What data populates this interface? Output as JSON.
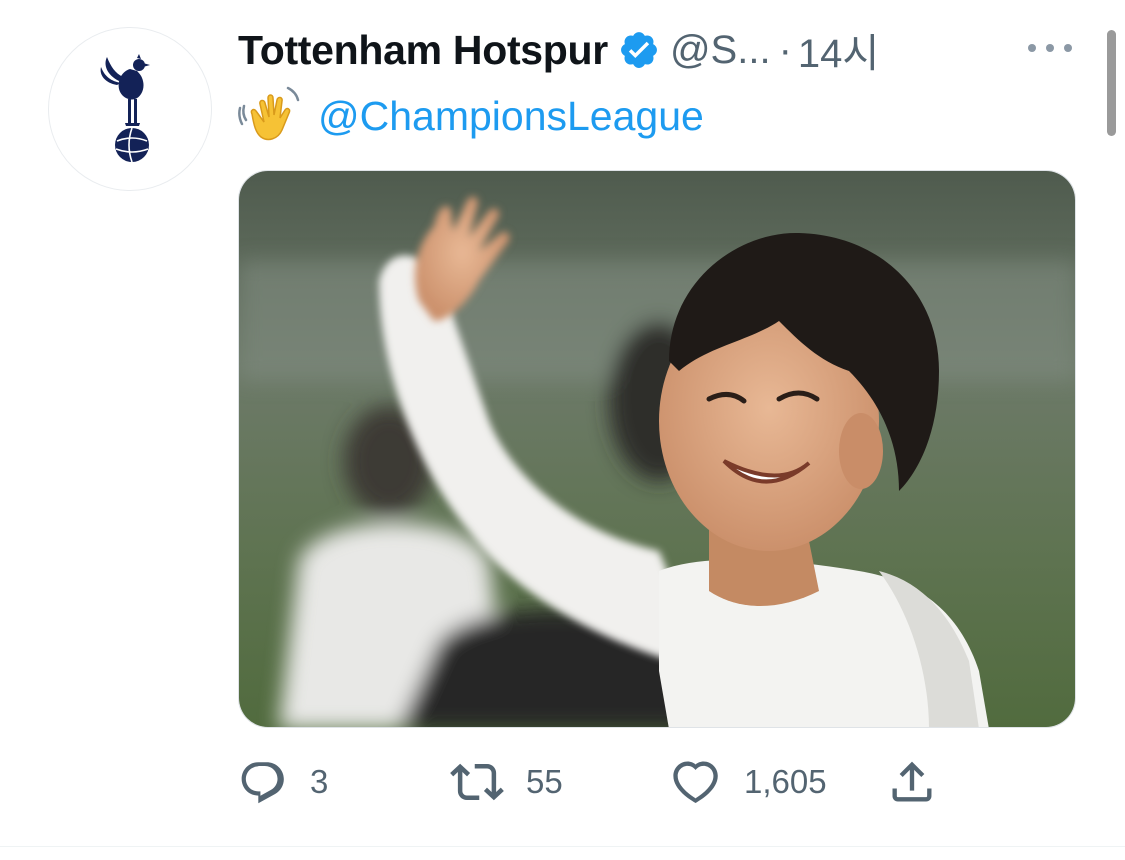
{
  "tweet": {
    "display_name": "Tottenham Hotspur",
    "handle": "@S...",
    "separator": "·",
    "time": "14시",
    "verified_icon": "verified-badge-icon",
    "text_emoji": "waving-hand-icon",
    "text_mention": "@ChampionsLeague",
    "media_alt": "photo",
    "more_icon": "more-options-icon"
  },
  "actions": {
    "reply": {
      "icon": "reply-icon",
      "count": "3"
    },
    "retweet": {
      "icon": "retweet-icon",
      "count": "55"
    },
    "like": {
      "icon": "heart-icon",
      "count": "1,605"
    },
    "share": {
      "icon": "share-icon"
    }
  },
  "colors": {
    "accent": "#1d9bf0",
    "text_primary": "#0f1419",
    "text_secondary": "#536471",
    "club_navy": "#132257"
  }
}
